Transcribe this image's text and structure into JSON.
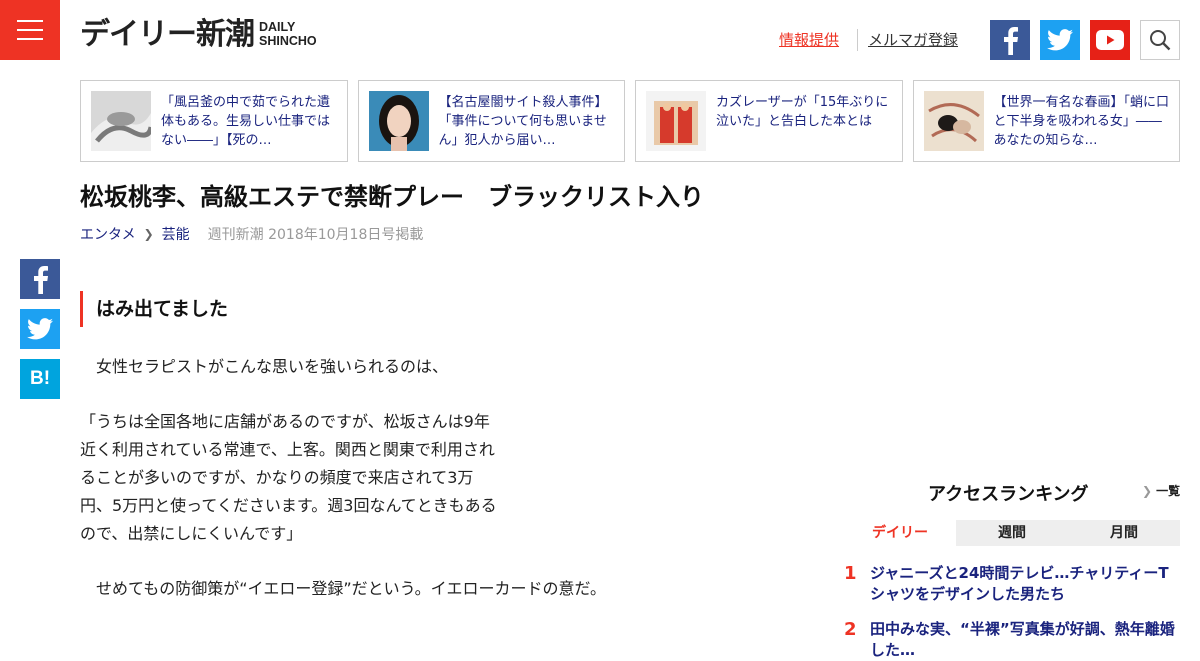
{
  "header": {
    "logo_jp": "デイリー新潮",
    "logo_en_line1": "DAILY",
    "logo_en_line2": "SHINCHO",
    "link_info": "情報提供",
    "link_mailmag": "メルマガ登録"
  },
  "related": [
    {
      "text": "「風呂釜の中で茹でられた遺体もある。生易しい仕事ではない――」【死の…"
    },
    {
      "text": "【名古屋闇サイト殺人事件】「事件について何も思いません」犯人から届い…"
    },
    {
      "text": "カズレーザーが「15年ぶりに泣いた」と告白した本とは"
    },
    {
      "text": "【世界一有名な春画】「蛸に口と下半身を吸われる女」――あなたの知らな…"
    }
  ],
  "article": {
    "title": "松坂桃李、高級エステで禁断プレー　ブラックリスト入り",
    "category": "エンタメ",
    "subcategory": "芸能",
    "published": "週刊新潮 2018年10月18日号掲載",
    "section_heading": "はみ出てました",
    "para1": "　女性セラピストがこんな思いを強いられるのは、",
    "para2": "「うちは全国各地に店舗があるのですが、松坂さんは9年近く利用されている常連で、上客。関西と関東で利用されることが多いのですが、かなりの頻度で来店されて3万円、5万円と使ってくださいます。週3回なんてときもあるので、出禁にしにくいんです」",
    "para3": "　せめてもの防御策が“イエロー登録”だという。イエローカードの意だ。"
  },
  "share": {
    "hatena": "B!"
  },
  "ranking": {
    "title": "アクセスランキング",
    "more": "一覧",
    "tabs": [
      "デイリー",
      "週間",
      "月間"
    ],
    "active_tab": "デイリー",
    "items": [
      {
        "rank": "1",
        "text": "ジャニーズと24時間テレビ…チャリティーTシャツをデザインした男たち"
      },
      {
        "rank": "2",
        "text": "田中みな実、“半裸”写真集が好調、熱年離婚した…"
      }
    ]
  },
  "colors": {
    "accent": "#ee3324",
    "link": "#1a237e",
    "facebook": "#3b5998",
    "twitter": "#1da1f2",
    "youtube": "#e62117",
    "hatena": "#00a4de"
  }
}
